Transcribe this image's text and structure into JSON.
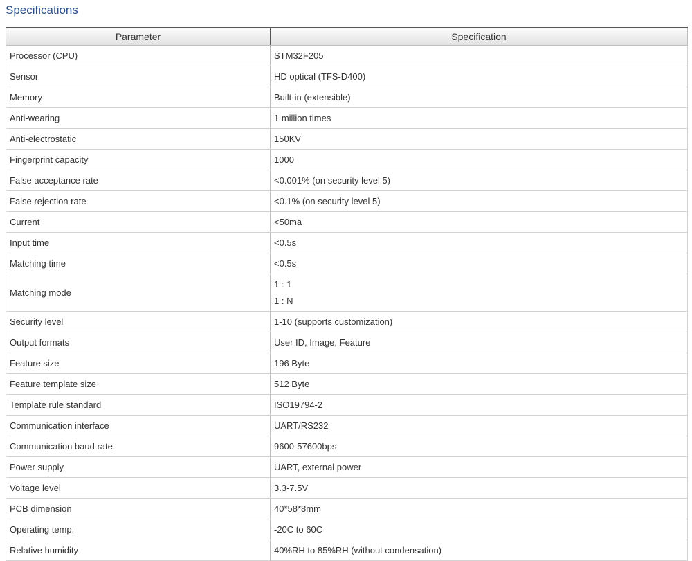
{
  "page": {
    "title": "Specifications"
  },
  "table": {
    "headers": [
      "Parameter",
      "Specification"
    ],
    "rows": [
      {
        "param": "Processor (CPU)",
        "spec": [
          "STM32F205"
        ]
      },
      {
        "param": "Sensor",
        "spec": [
          "HD optical (TFS-D400)"
        ]
      },
      {
        "param": "Memory",
        "spec": [
          "Built-in (extensible)"
        ]
      },
      {
        "param": "Anti-wearing",
        "spec": [
          "1 million times"
        ]
      },
      {
        "param": "Anti-electrostatic",
        "spec": [
          "150KV"
        ]
      },
      {
        "param": "Fingerprint capacity",
        "spec": [
          "1000"
        ]
      },
      {
        "param": "False acceptance rate",
        "spec": [
          "<0.001% (on security level 5)"
        ]
      },
      {
        "param": "False rejection rate",
        "spec": [
          "<0.1% (on security level 5)"
        ]
      },
      {
        "param": "Current",
        "spec": [
          "<50ma"
        ]
      },
      {
        "param": "Input time",
        "spec": [
          "<0.5s"
        ]
      },
      {
        "param": "Matching time",
        "spec": [
          "<0.5s"
        ]
      },
      {
        "param": "Matching mode",
        "spec": [
          "1 : 1",
          "1 : N"
        ]
      },
      {
        "param": "Security level",
        "spec": [
          "1-10 (supports customization)"
        ]
      },
      {
        "param": "Output formats",
        "spec": [
          "User ID, Image, Feature"
        ]
      },
      {
        "param": "Feature size",
        "spec": [
          "196 Byte"
        ]
      },
      {
        "param": "Feature template size",
        "spec": [
          "512 Byte"
        ]
      },
      {
        "param": "Template rule standard",
        "spec": [
          "ISO19794-2"
        ]
      },
      {
        "param": "Communication interface",
        "spec": [
          "UART/RS232"
        ]
      },
      {
        "param": "Communication baud rate",
        "spec": [
          "9600-57600bps"
        ]
      },
      {
        "param": "Power supply",
        "spec": [
          "UART, external power"
        ]
      },
      {
        "param": "Voltage level",
        "spec": [
          "3.3-7.5V"
        ]
      },
      {
        "param": "PCB dimension",
        "spec": [
          "40*58*8mm"
        ]
      },
      {
        "param": "Operating temp.",
        "spec": [
          "-20C to 60C"
        ]
      },
      {
        "param": "Relative humidity",
        "spec": [
          "40%RH to 85%RH (without condensation)"
        ]
      }
    ]
  }
}
